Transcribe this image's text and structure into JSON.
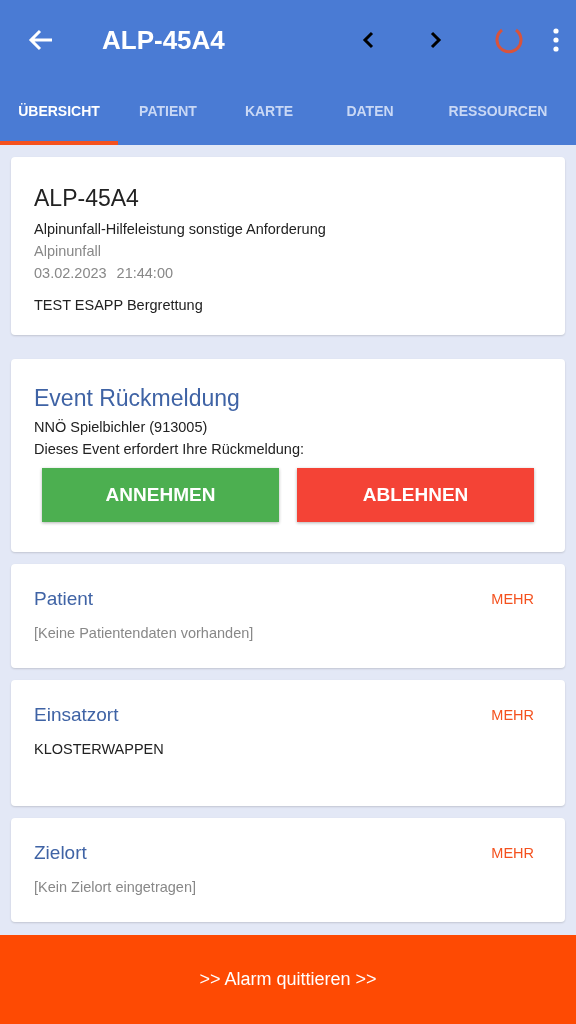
{
  "app_bar": {
    "title": "ALP-45A4"
  },
  "tabs": [
    {
      "label": "ÜBERSICHT",
      "selected": true
    },
    {
      "label": "PATIENT",
      "selected": false
    },
    {
      "label": "KARTE",
      "selected": false
    },
    {
      "label": "DATEN",
      "selected": false
    },
    {
      "label": "RESSOURCEN",
      "selected": false
    }
  ],
  "summary": {
    "title": "ALP-45A4",
    "description": "Alpinunfall-Hilfeleistung sonstige Anforderung",
    "category": "Alpinunfall",
    "date": "03.02.2023",
    "time": "21:44:00",
    "note": "TEST ESAPP Bergrettung"
  },
  "feedback": {
    "title": "Event Rückmeldung",
    "unit": "NNÖ Spielbichler (913005)",
    "prompt": "Dieses Event erfordert Ihre Rückmeldung:",
    "buttons": [
      {
        "label": "ANNEHMEN",
        "kind": "accept"
      },
      {
        "label": "ABLEHNEN",
        "kind": "reject"
      }
    ]
  },
  "sections": [
    {
      "title": "Patient",
      "more": "MEHR",
      "text": "[Keine Patientendaten vorhanden]",
      "muted": true
    },
    {
      "title": "Einsatzort",
      "more": "MEHR",
      "text": "KLOSTERWAPPEN",
      "muted": false
    },
    {
      "title": "Zielort",
      "more": "MEHR",
      "text": "[Kein Zielort eingetragen]",
      "muted": true
    }
  ],
  "footer": {
    "label": ">> Alarm quittieren >>"
  }
}
